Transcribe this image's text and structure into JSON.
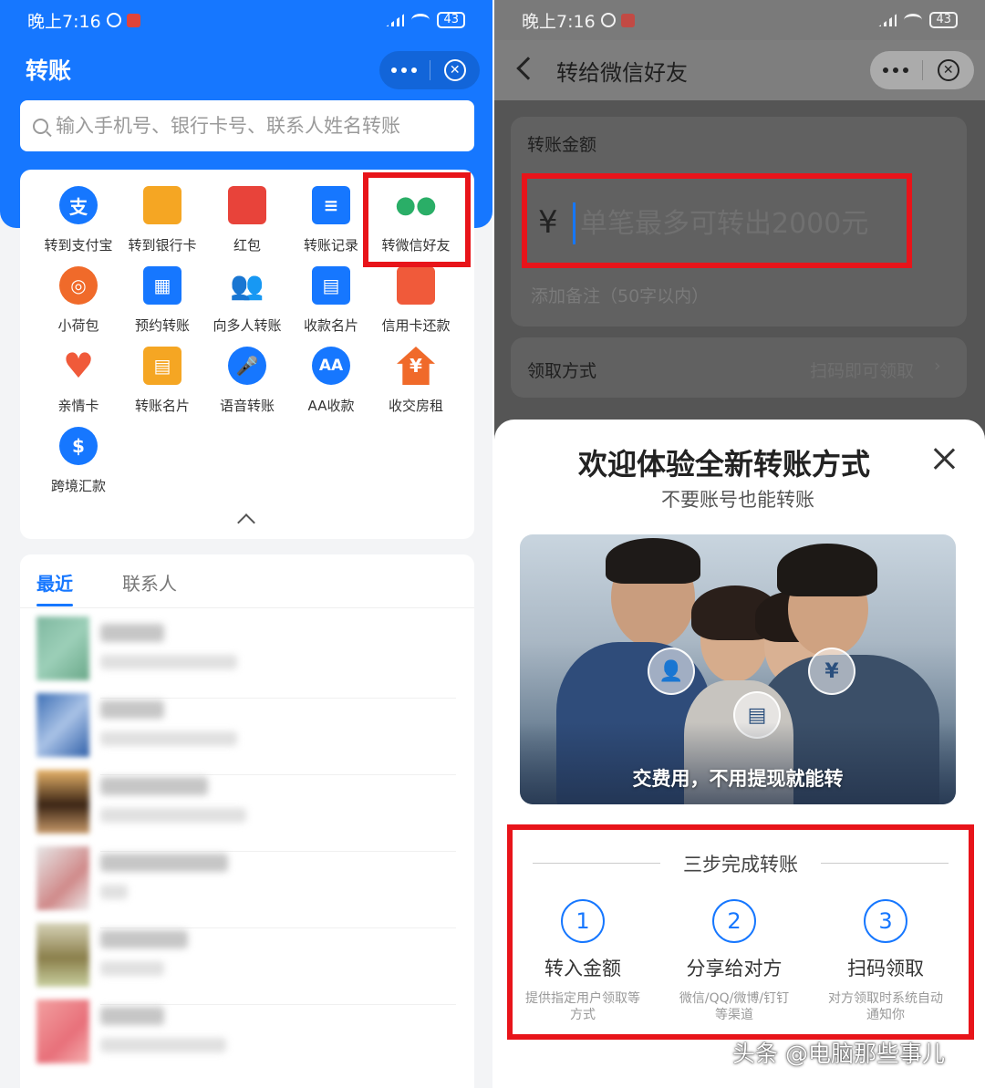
{
  "status_bar": {
    "time": "晚上7:16",
    "battery": "43"
  },
  "left": {
    "title": "转账",
    "search": {
      "placeholder": "输入手机号、银行卡号、联系人姓名转账"
    },
    "grid": [
      {
        "label": "转到支付宝",
        "icon": "alipay-icon",
        "color": "#1677ff",
        "glyph": "支"
      },
      {
        "label": "转到银行卡",
        "icon": "bank-card-icon",
        "color": "#f5a623",
        "glyph": ""
      },
      {
        "label": "红包",
        "icon": "red-packet-icon",
        "color": "#e8433a",
        "glyph": ""
      },
      {
        "label": "转账记录",
        "icon": "records-icon",
        "color": "#1677ff",
        "glyph": "≡"
      },
      {
        "label": "转微信好友",
        "icon": "wechat-icon",
        "color": "#2aae67",
        "glyph": "●●"
      },
      {
        "label": "小荷包",
        "icon": "pouch-icon",
        "color": "#f06a2a",
        "glyph": "◎"
      },
      {
        "label": "预约转账",
        "icon": "calendar-icon",
        "color": "#1677ff",
        "glyph": "▦"
      },
      {
        "label": "向多人转账",
        "icon": "multi-user-icon",
        "color": "#1677ff",
        "glyph": "👥"
      },
      {
        "label": "收款名片",
        "icon": "receive-card-icon",
        "color": "#1677ff",
        "glyph": "▤"
      },
      {
        "label": "信用卡还款",
        "icon": "credit-card-icon",
        "color": "#f05a3a",
        "glyph": ""
      },
      {
        "label": "亲情卡",
        "icon": "family-card-icon",
        "color": "#f05a3a",
        "glyph": "♥"
      },
      {
        "label": "转账名片",
        "icon": "transfer-card-icon",
        "color": "#f5a623",
        "glyph": "▤"
      },
      {
        "label": "语音转账",
        "icon": "voice-icon",
        "color": "#1677ff",
        "glyph": "🎤"
      },
      {
        "label": "AA收款",
        "icon": "aa-icon",
        "color": "#1677ff",
        "glyph": "AA"
      },
      {
        "label": "收交房租",
        "icon": "house-rent-icon",
        "color": "#f06a2a",
        "glyph": "¥"
      },
      {
        "label": "跨境汇款",
        "icon": "cross-border-icon",
        "color": "#1677ff",
        "glyph": "$"
      }
    ],
    "tabs": {
      "recent": "最近",
      "contacts": "联系人"
    }
  },
  "right": {
    "nav_title": "转给微信好友",
    "amount_label": "转账金额",
    "currency": "¥",
    "amount_placeholder": "单笔最多可转出2000元",
    "remark_placeholder": "添加备注（50字以内）",
    "method_label": "领取方式",
    "method_value": "扫码即可领取",
    "sheet": {
      "title": "欢迎体验全新转账方式",
      "subtitle": "不要账号也能转账",
      "banner_caption": "交费用，不用提现就能转",
      "steps_heading": "三步完成转账",
      "steps": [
        {
          "num": "1",
          "title": "转入金额",
          "desc_line1": "提供指定用户领取等",
          "desc_line2": "方式"
        },
        {
          "num": "2",
          "title": "分享给对方",
          "desc_line1": "微信/QQ/微博/钉钉",
          "desc_line2": "等渠道"
        },
        {
          "num": "3",
          "title": "扫码领取",
          "desc_line1": "对方领取时系统自动",
          "desc_line2": "通知你"
        }
      ]
    }
  },
  "watermark": "头条 @电脑那些事儿"
}
